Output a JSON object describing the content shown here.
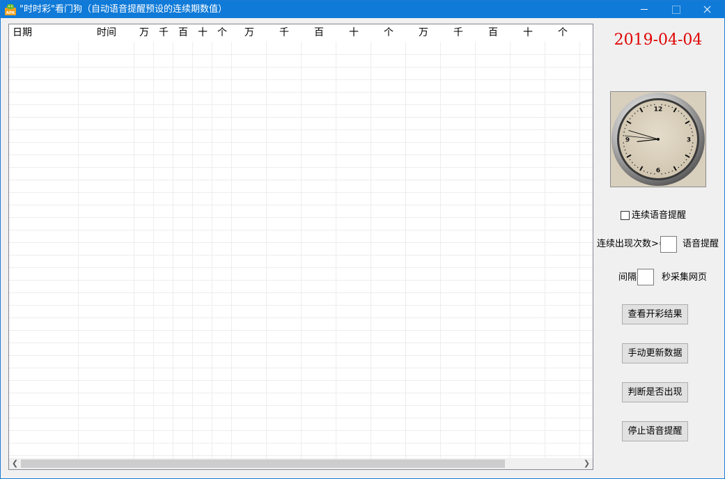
{
  "window": {
    "title": "\"时时彩\"看门狗（自动语音提醒预设的连续期数值）",
    "accent_color": "#0f7ad8",
    "controls": {
      "minimize": "minimize-icon",
      "maximize": "maximize-icon",
      "close": "close-icon"
    }
  },
  "grid": {
    "columns": [
      {
        "label": "日期"
      },
      {
        "label": "时间"
      },
      {
        "label": "万"
      },
      {
        "label": "千"
      },
      {
        "label": "百"
      },
      {
        "label": "十"
      },
      {
        "label": "个"
      },
      {
        "label": "万"
      },
      {
        "label": "千"
      },
      {
        "label": "百"
      },
      {
        "label": "十"
      },
      {
        "label": "个"
      },
      {
        "label": "万"
      },
      {
        "label": "千"
      },
      {
        "label": "百"
      },
      {
        "label": "十"
      },
      {
        "label": "个"
      }
    ],
    "rows": []
  },
  "sidebar": {
    "date": "2019-04-04",
    "date_color": "#e00000",
    "clock": {
      "hour_marks": [
        "12",
        "3",
        "6",
        "9"
      ],
      "time": {
        "hour": 8,
        "minute": 47,
        "second": 46
      }
    },
    "voice_alert_checkbox": {
      "label": "连续语音提醒",
      "checked": false
    },
    "consecutive_count": {
      "prefix": "连续出现次数>=",
      "value": "",
      "suffix": "语音提醒"
    },
    "interval": {
      "prefix": "间隔",
      "value": "",
      "suffix": "秒采集网页"
    },
    "buttons": {
      "view_results": "查看开彩结果",
      "manual_update": "手动更新数据",
      "check_occurrence": "判断是否出现",
      "stop_voice": "停止语音提醒"
    }
  }
}
